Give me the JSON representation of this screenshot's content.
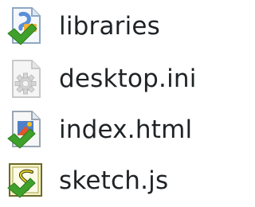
{
  "files": [
    {
      "name": "libraries",
      "icon": "folder-shortcut-icon"
    },
    {
      "name": "desktop.ini",
      "icon": "ini-settings-file-icon"
    },
    {
      "name": "index.html",
      "icon": "html-document-icon"
    },
    {
      "name": "sketch.js",
      "icon": "js-script-icon"
    }
  ],
  "colors": {
    "text": "#1f2326",
    "check_green": "#3fa12c",
    "folder_blue": "#5a8fd6",
    "script_yellow": "#e4d21e"
  }
}
